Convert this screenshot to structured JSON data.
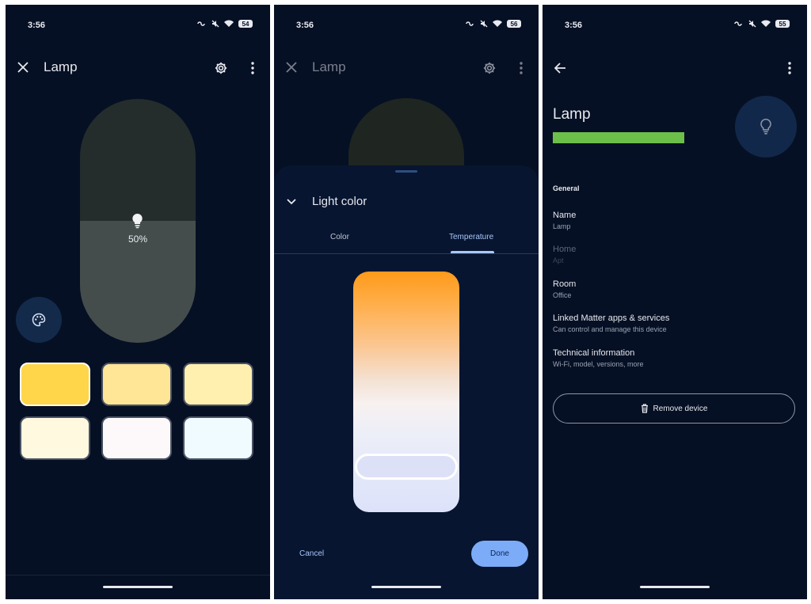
{
  "status": [
    {
      "time": "3:56",
      "battery": "54"
    },
    {
      "time": "3:56",
      "battery": "56"
    },
    {
      "time": "3:56",
      "battery": "55"
    }
  ],
  "device_screen": {
    "title": "Lamp",
    "brightness_label": "50%",
    "brightness_level": 0.5,
    "swatches": [
      {
        "color": "#ffd54a",
        "selected": true
      },
      {
        "color": "#ffe697"
      },
      {
        "color": "#fff0b0"
      },
      {
        "color": "#fff9e0"
      },
      {
        "color": "#fdf9fb"
      },
      {
        "color": "#f0fbff"
      }
    ]
  },
  "light_color_sheet": {
    "header_title": "Lamp",
    "sheet_title": "Light color",
    "tabs": [
      {
        "label": "Color",
        "active": false
      },
      {
        "label": "Temperature",
        "active": true
      }
    ],
    "temperature_position": 0.85,
    "cancel_label": "Cancel",
    "done_label": "Done"
  },
  "settings_screen": {
    "device_name": "Lamp",
    "section": "General",
    "items": [
      {
        "title": "Name",
        "subtitle": "Lamp"
      },
      {
        "title": "Home",
        "subtitle": "Apt",
        "disabled": true
      },
      {
        "title": "Room",
        "subtitle": "Office"
      },
      {
        "title": "Linked Matter apps & services",
        "subtitle": "Can control and manage this device"
      },
      {
        "title": "Technical information",
        "subtitle": "Wi-Fi, model, versions, more"
      }
    ],
    "remove_label": "Remove device"
  },
  "colors": {
    "accent": "#a8c7fa",
    "done_button": "#7cacf8",
    "highlight_bar": "#6cc04a",
    "background": "#061024"
  }
}
